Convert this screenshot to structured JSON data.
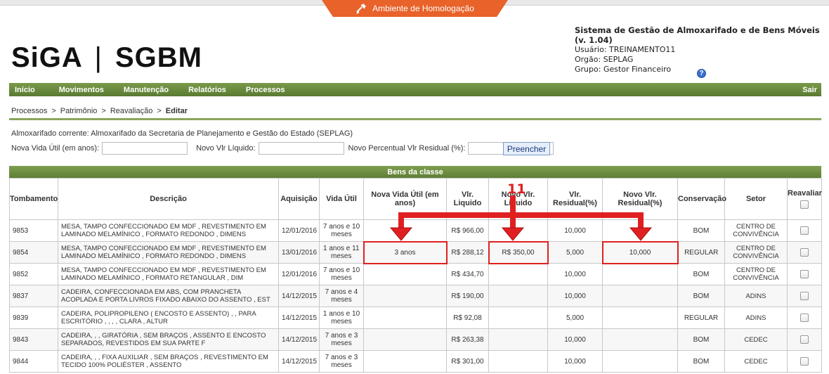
{
  "env_banner": {
    "label": "Ambiente de Homologação",
    "icon": "tools-icon"
  },
  "logo": {
    "left": "SiGA",
    "sep": "|",
    "right": "SGBM"
  },
  "system": {
    "title": "Sistema de Gestão de Almoxarifado e de Bens Móveis (v. 1.04)",
    "user": "Usuário: TREINAMENTO11",
    "org": "Orgão: SEPLAG",
    "group": "Grupo: Gestor Financeiro",
    "help": "?"
  },
  "menu": {
    "items": [
      "Início",
      "Movimentos",
      "Manutenção",
      "Relatórios",
      "Processos"
    ],
    "logout": "Sair"
  },
  "breadcrumb": {
    "items": [
      "Processos",
      "Patrimônio",
      "Reavaliação"
    ],
    "current": "Editar",
    "sep": ">"
  },
  "almox": "Almoxarifado corrente: Almoxarifado da Secretaria de Planejamento e Gestão do Estado (SEPLAG)",
  "form": {
    "vida_label": "Nova Vida Útil (em anos):",
    "vlr_label": "Novo Vlr Líquido:",
    "perc_label": "Novo Percentual Vlr Residual (%):",
    "fill_button": "Preencher"
  },
  "grid": {
    "title": "Bens da classe",
    "headers": [
      "Tombamento",
      "Descrição",
      "Aquisição",
      "Vida Útil",
      "Nova Vida Útil (em anos)",
      "Vlr. Liquido",
      "Novo Vlr. Liquido",
      "Vlr. Residual(%)",
      "Novo Vlr. Residual(%)",
      "Conservação",
      "Setor",
      "Reavaliar"
    ],
    "rows": [
      {
        "tomb": "9853",
        "desc": "MESA, TAMPO CONFECCIONADO EM MDF , REVESTIMENTO EM LAMINADO MELAMÍNICO , FORMATO REDONDO , DIMENS",
        "aq": "12/01/2016",
        "vida": "7 anos e 10 meses",
        "nova_vida": "",
        "vlr": "R$ 966,00",
        "novo_vlr": "",
        "res": "10,000",
        "novo_res": "",
        "cons": "BOM",
        "setor": "CENTRO DE CONVIVÊNCIA"
      },
      {
        "tomb": "9854",
        "desc": "MESA, TAMPO CONFECCIONADO EM MDF , REVESTIMENTO EM LAMINADO MELAMÍNICO , FORMATO REDONDO , DIMENS",
        "aq": "13/01/2016",
        "vida": "1 anos e 11 meses",
        "nova_vida": "3 anos",
        "vlr": "R$ 288,12",
        "novo_vlr": "R$ 350,00",
        "res": "5,000",
        "novo_res": "10,000",
        "cons": "REGULAR",
        "setor": "CENTRO DE CONVIVÊNCIA"
      },
      {
        "tomb": "9852",
        "desc": "MESA, TAMPO CONFECCIONADO EM MDF , REVESTIMENTO EM LAMINADO MELAMÍNICO , FORMATO RETANGULAR , DIM",
        "aq": "12/01/2016",
        "vida": "7 anos e 10 meses",
        "nova_vida": "",
        "vlr": "R$ 434,70",
        "novo_vlr": "",
        "res": "10,000",
        "novo_res": "",
        "cons": "BOM",
        "setor": "CENTRO DE CONVIVÊNCIA"
      },
      {
        "tomb": "9837",
        "desc": "CADEIRA, CONFECCIONADA EM ABS, COM PRANCHETA ACOPLADA E PORTA LIVROS FIXADO ABAIXO DO ASSENTO , EST",
        "aq": "14/12/2015",
        "vida": "7 anos e 4 meses",
        "nova_vida": "",
        "vlr": "R$ 190,00",
        "novo_vlr": "",
        "res": "10,000",
        "novo_res": "",
        "cons": "BOM",
        "setor": "ADINS"
      },
      {
        "tomb": "9839",
        "desc": "CADEIRA, POLIPROPILENO ( ENCOSTO E ASSENTO) , , PARA ESCRITÓRIO , , , , CLARA , ALTUR",
        "aq": "14/12/2015",
        "vida": "1 anos e 10 meses",
        "nova_vida": "",
        "vlr": "R$ 92,08",
        "novo_vlr": "",
        "res": "5,000",
        "novo_res": "",
        "cons": "REGULAR",
        "setor": "ADINS"
      },
      {
        "tomb": "9843",
        "desc": "CADEIRA, , , GIRATÓRIA , SEM BRAÇOS , ASSENTO E ENCOSTO SEPARADOS, REVESTIDOS EM SUA PARTE F",
        "aq": "14/12/2015",
        "vida": "7 anos e 3 meses",
        "nova_vida": "",
        "vlr": "R$ 263,38",
        "novo_vlr": "",
        "res": "10,000",
        "novo_res": "",
        "cons": "BOM",
        "setor": "CEDEC"
      },
      {
        "tomb": "9844",
        "desc": "CADEIRA, , , FIXA AUXILIAR , SEM BRAÇOS , REVESTIMENTO EM TECIDO 100% POLIÉSTER , ASSENTO",
        "aq": "14/12/2015",
        "vida": "7 anos e 3 meses",
        "nova_vida": "",
        "vlr": "R$ 301,00",
        "novo_vlr": "",
        "res": "10,000",
        "novo_res": "",
        "cons": "BOM",
        "setor": "CEDEC"
      }
    ]
  },
  "annotation": {
    "number": "11",
    "color": "#e02020"
  }
}
